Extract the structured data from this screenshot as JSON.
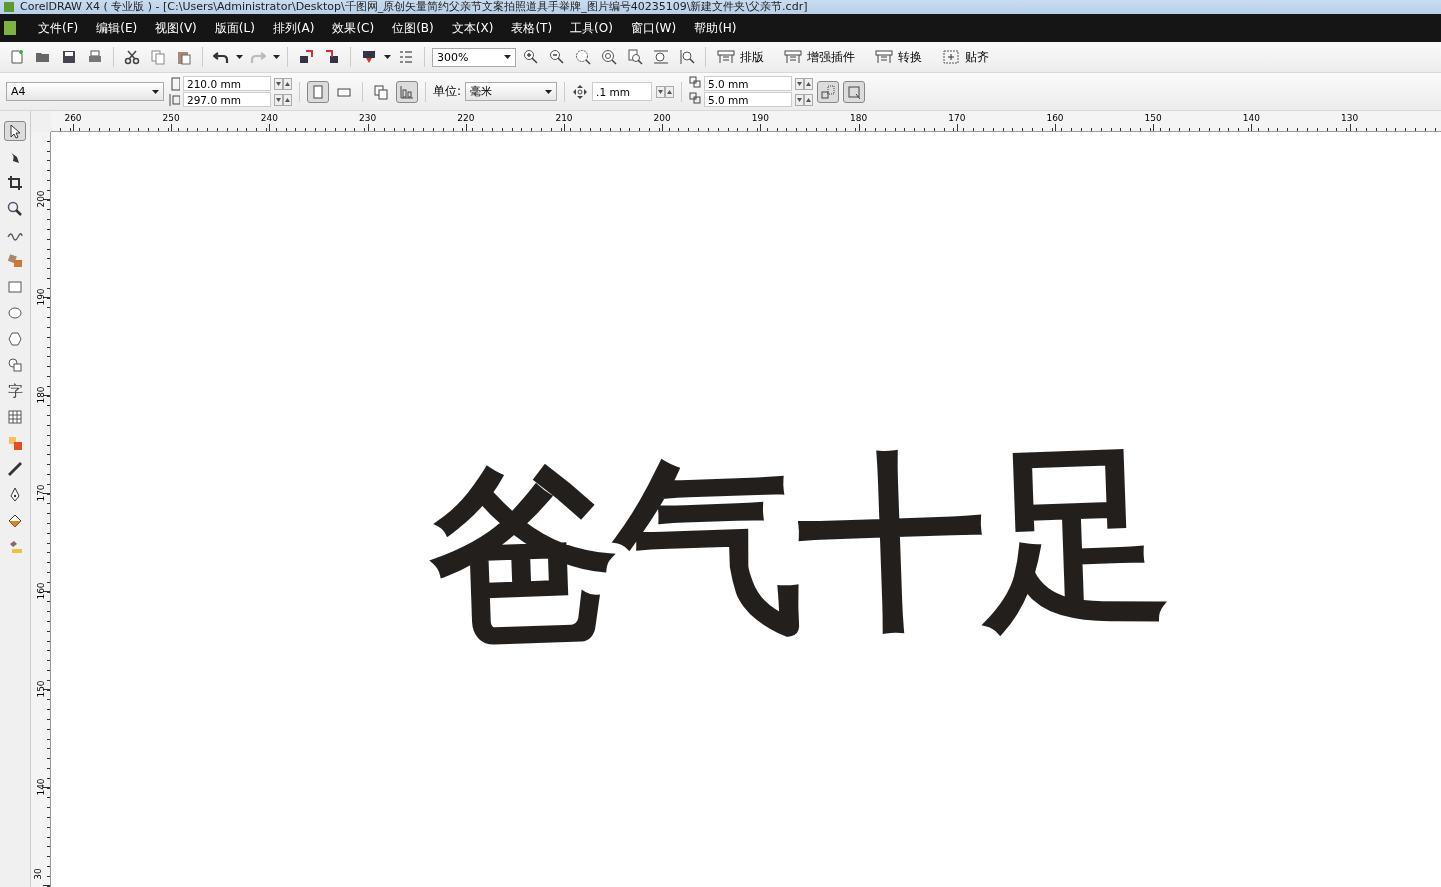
{
  "window": {
    "title": "CorelDRAW X4 ( 专业版 ) - [C:\\Users\\Administrator\\Desktop\\千图网_原创矢量简约父亲节文案拍照道具手举牌_图片编号40235109\\新建文件夹\\父亲节.cdr]"
  },
  "menu": [
    {
      "label": "文件(F)"
    },
    {
      "label": "编辑(E)"
    },
    {
      "label": "视图(V)"
    },
    {
      "label": "版面(L)"
    },
    {
      "label": "排列(A)"
    },
    {
      "label": "效果(C)"
    },
    {
      "label": "位图(B)"
    },
    {
      "label": "文本(X)"
    },
    {
      "label": "表格(T)"
    },
    {
      "label": "工具(O)"
    },
    {
      "label": "窗口(W)"
    },
    {
      "label": "帮助(H)"
    }
  ],
  "standard_toolbar": {
    "zoom": "300%",
    "plugin_buttons": [
      {
        "label": "排版"
      },
      {
        "label": "增强插件"
      },
      {
        "label": "转换"
      },
      {
        "label": "贴齐"
      }
    ]
  },
  "property_bar": {
    "page_size": "A4",
    "width": "210.0 mm",
    "height": "297.0 mm",
    "orientation": [
      {
        "selected": true
      },
      {
        "selected": false
      }
    ],
    "page_scope": [
      {
        "selected": false
      },
      {
        "selected": true
      }
    ],
    "units_label": "单位:",
    "units": "毫米",
    "nudge": ".1 mm",
    "duplicate_x": "5.0 mm",
    "duplicate_y": "5.0 mm",
    "object_buttons": [
      {
        "selected": true
      },
      {
        "selected": true
      }
    ]
  },
  "toolbox": [
    {
      "kind": "icon",
      "selected": true
    },
    {
      "kind": "icon",
      "selected": false
    },
    {
      "kind": "icon",
      "selected": false
    },
    {
      "kind": "icon",
      "selected": false
    },
    {
      "kind": "icon",
      "selected": false
    },
    {
      "kind": "icon",
      "selected": false
    },
    {
      "kind": "icon",
      "selected": false
    },
    {
      "kind": "icon",
      "selected": false
    },
    {
      "kind": "icon",
      "selected": false
    },
    {
      "kind": "icon",
      "selected": false
    },
    {
      "kind": "glyph",
      "glyph": "字",
      "selected": false
    },
    {
      "kind": "icon",
      "selected": false
    },
    {
      "kind": "icon",
      "selected": false
    },
    {
      "kind": "icon",
      "selected": false
    },
    {
      "kind": "icon",
      "selected": false
    },
    {
      "kind": "icon",
      "selected": false
    },
    {
      "kind": "icon",
      "selected": false
    }
  ],
  "rulers": {
    "horizontal": [
      "260",
      "250",
      "240",
      "230",
      "220",
      "210",
      "200",
      "190",
      "180",
      "170",
      "160",
      "150",
      "140",
      "130"
    ],
    "vertical": [
      "200",
      "190",
      "180",
      "170",
      "160",
      "150",
      "140",
      "30"
    ]
  },
  "canvas": {
    "artwork_text": "爸气十足"
  }
}
